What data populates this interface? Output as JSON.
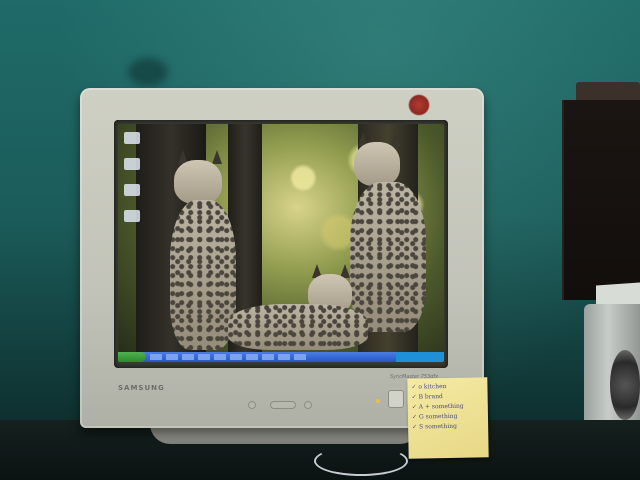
{
  "monitor": {
    "brand": "SAMSUNG",
    "model": "SyncMaster 753dfx"
  },
  "screen": {
    "wallpaper": "lynx family in forest",
    "desktop_icon_count": 4
  },
  "sticky_note": {
    "lines": [
      "✓ o kitchen",
      "✓ B brand",
      "✓ A + something",
      "✓ G something",
      "✓ S something"
    ]
  },
  "colors": {
    "wall": "#1f6b69",
    "monitor_case": "#cfd0c4",
    "taskbar": "#2456c8",
    "note": "#f4eaa3"
  }
}
